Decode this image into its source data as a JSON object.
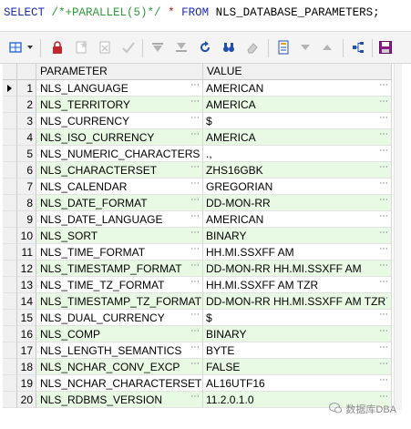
{
  "sql": {
    "select": "SELECT",
    "hint": "/*+PARALLEL(5)*/",
    "star": "*",
    "from": "FROM",
    "table": "NLS_DATABASE_PARAMETERS;"
  },
  "columns": [
    "PARAMETER",
    "VALUE"
  ],
  "rows": [
    {
      "n": "1",
      "p": "NLS_LANGUAGE",
      "v": "AMERICAN"
    },
    {
      "n": "2",
      "p": "NLS_TERRITORY",
      "v": "AMERICA"
    },
    {
      "n": "3",
      "p": "NLS_CURRENCY",
      "v": "$"
    },
    {
      "n": "4",
      "p": "NLS_ISO_CURRENCY",
      "v": "AMERICA"
    },
    {
      "n": "5",
      "p": "NLS_NUMERIC_CHARACTERS",
      "v": ".,"
    },
    {
      "n": "6",
      "p": "NLS_CHARACTERSET",
      "v": "ZHS16GBK"
    },
    {
      "n": "7",
      "p": "NLS_CALENDAR",
      "v": "GREGORIAN"
    },
    {
      "n": "8",
      "p": "NLS_DATE_FORMAT",
      "v": "DD-MON-RR"
    },
    {
      "n": "9",
      "p": "NLS_DATE_LANGUAGE",
      "v": "AMERICAN"
    },
    {
      "n": "10",
      "p": "NLS_SORT",
      "v": "BINARY"
    },
    {
      "n": "11",
      "p": "NLS_TIME_FORMAT",
      "v": "HH.MI.SSXFF AM"
    },
    {
      "n": "12",
      "p": "NLS_TIMESTAMP_FORMAT",
      "v": "DD-MON-RR HH.MI.SSXFF AM"
    },
    {
      "n": "13",
      "p": "NLS_TIME_TZ_FORMAT",
      "v": "HH.MI.SSXFF AM TZR"
    },
    {
      "n": "14",
      "p": "NLS_TIMESTAMP_TZ_FORMAT",
      "v": "DD-MON-RR HH.MI.SSXFF AM TZR"
    },
    {
      "n": "15",
      "p": "NLS_DUAL_CURRENCY",
      "v": "$"
    },
    {
      "n": "16",
      "p": "NLS_COMP",
      "v": "BINARY"
    },
    {
      "n": "17",
      "p": "NLS_LENGTH_SEMANTICS",
      "v": "BYTE"
    },
    {
      "n": "18",
      "p": "NLS_NCHAR_CONV_EXCP",
      "v": "FALSE"
    },
    {
      "n": "19",
      "p": "NLS_NCHAR_CHARACTERSET",
      "v": "AL16UTF16"
    },
    {
      "n": "20",
      "p": "NLS_RDBMS_VERSION",
      "v": "11.2.0.1.0"
    }
  ],
  "watermark": "数据库DBA",
  "colors": {
    "row_alt": "#e8fae4",
    "row_plain": "#ffffff",
    "toolbar_red": "#b22222",
    "toolbar_blue": "#1f4fb0"
  }
}
